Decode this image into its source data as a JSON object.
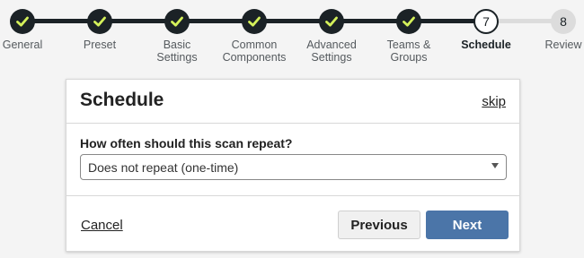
{
  "wizard": {
    "steps": [
      {
        "label": "General",
        "status": "done"
      },
      {
        "label": "Preset",
        "status": "done"
      },
      {
        "label": "Basic\nSettings",
        "status": "done"
      },
      {
        "label": "Common\nComponents",
        "status": "done"
      },
      {
        "label": "Advanced\nSettings",
        "status": "done"
      },
      {
        "label": "Teams &\nGroups",
        "status": "done"
      },
      {
        "label": "Schedule",
        "status": "current",
        "number": "7"
      },
      {
        "label": "Review",
        "status": "upcoming",
        "number": "8"
      }
    ],
    "colors": {
      "done": "#1b2226",
      "check": "#d4f05a",
      "pending": "#dcdcdc"
    }
  },
  "card": {
    "title": "Schedule",
    "skip_label": "skip",
    "question": "How often should this scan repeat?",
    "repeat_select": {
      "value": "Does not repeat (one-time)"
    },
    "cancel_label": "Cancel",
    "previous_label": "Previous",
    "next_label": "Next",
    "accent": "#4b75a8"
  }
}
